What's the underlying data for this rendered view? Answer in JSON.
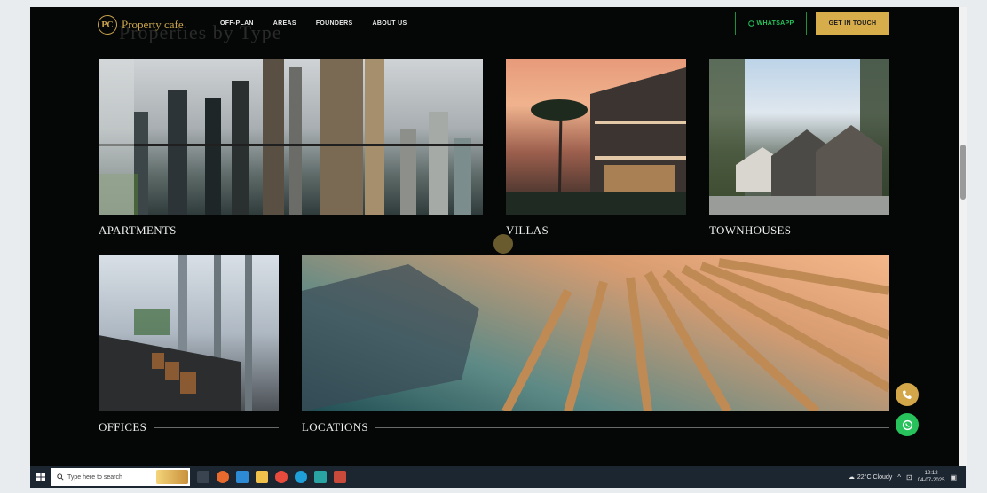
{
  "header": {
    "logo_mark": "PC",
    "logo_text": "Property cafe",
    "ghost_title": "Properties by Type",
    "nav": [
      "OFF-PLAN",
      "AREAS",
      "FOUNDERS",
      "ABOUT US"
    ],
    "whatsapp_label": "WHATSAPP",
    "cta_label": "GET IN TOUCH"
  },
  "categories": {
    "apartments": "APARTMENTS",
    "villas": "VILLAS",
    "townhouses": "TOWNHOUSES",
    "offices": "OFFICES",
    "locations": "LOCATIONS"
  },
  "taskbar": {
    "search_placeholder": "Type here to search",
    "weather": "22°C Cloudy",
    "time": "12:12",
    "date": "04-07-2025"
  },
  "colors": {
    "gold": "#d7ad4c",
    "whatsapp_green": "#25c25a",
    "page_bg": "#050707"
  }
}
